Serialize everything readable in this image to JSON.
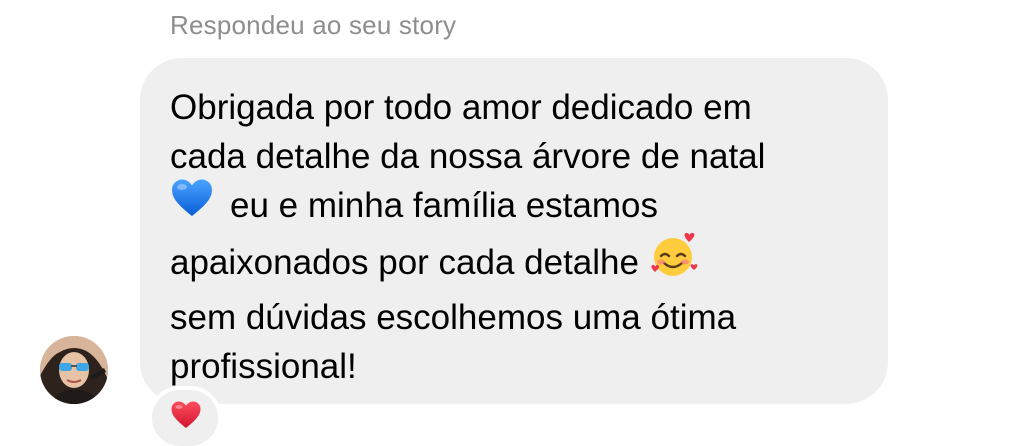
{
  "header": {
    "reply_label": "Respondeu ao seu story"
  },
  "message": {
    "line1": "Obrigada por todo amor dedicado em",
    "line2": "cada detalhe da nossa árvore de natal",
    "line3_text": "eu e minha família estamos",
    "line4_text": "apaixonados por cada detalhe",
    "line5": "sem dúvidas escolhemos uma ótima",
    "line6": "profissional!",
    "emojis": [
      "blue-heart-icon",
      "smiling-face-with-hearts-icon"
    ]
  },
  "reaction": {
    "icon": "red-heart-icon",
    "color": "#e0245e"
  },
  "colors": {
    "bubble": "#efefef",
    "muted_text": "#8e8e8e",
    "blue_heart": "#1877f2"
  }
}
